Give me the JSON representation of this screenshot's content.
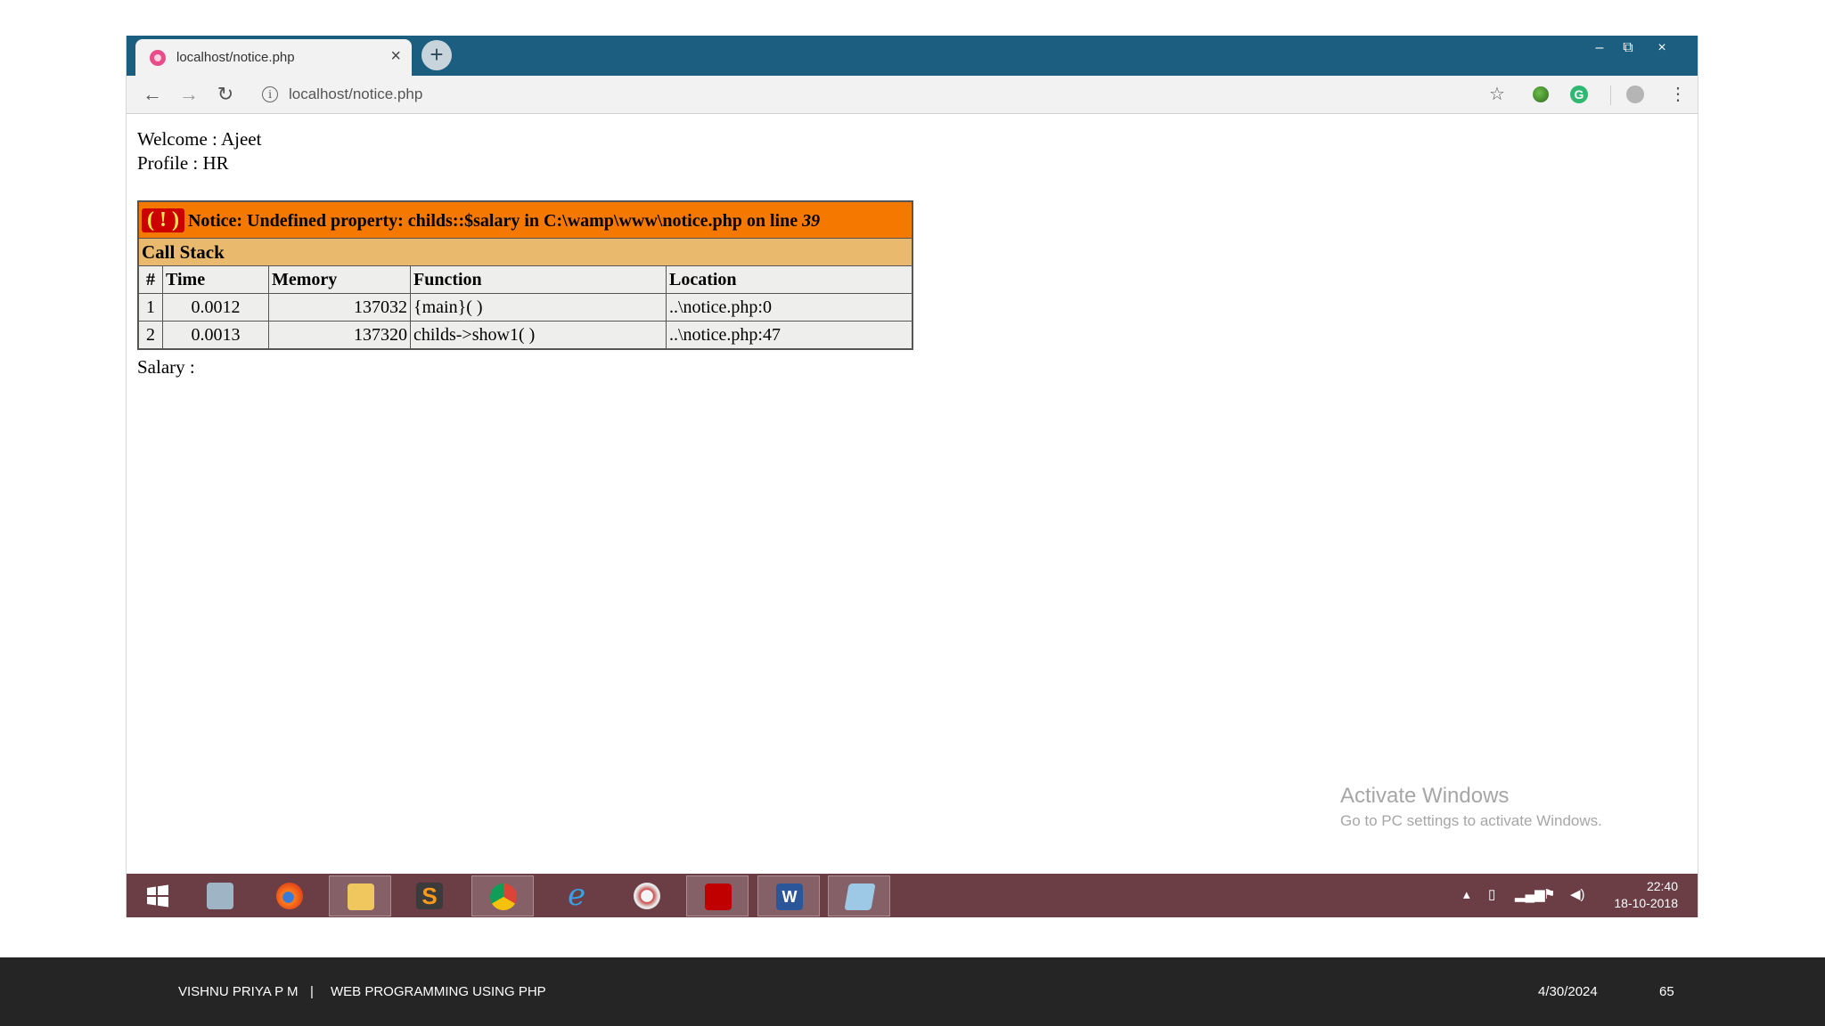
{
  "browser": {
    "tab_title": "localhost/notice.php",
    "tab_close": "×",
    "new_tab": "+",
    "url": "localhost/notice.php",
    "window_controls": {
      "minimize": "–",
      "restore": "⧉",
      "close": "×"
    }
  },
  "page": {
    "welcome": "Welcome : Ajeet",
    "profile": "Profile : HR",
    "notice": {
      "icon": "( ! )",
      "message": "Notice: Undefined property: childs::$salary in C:\\wamp\\www\\notice.php on line ",
      "line": "39"
    },
    "call_stack": {
      "title": "Call Stack",
      "headers": [
        "#",
        "Time",
        "Memory",
        "Function",
        "Location"
      ],
      "rows": [
        [
          "1",
          "0.0012",
          "137032",
          "{main}( )",
          "..\\notice.php:0"
        ],
        [
          "2",
          "0.0013",
          "137320",
          "childs->show1( )",
          "..\\notice.php:47"
        ]
      ]
    },
    "salary": "Salary :"
  },
  "watermark": {
    "title": "Activate Windows",
    "subtitle": "Go to PC settings to activate Windows."
  },
  "taskbar": {
    "apps": [
      "start-icon",
      "calculator-icon",
      "firefox-icon",
      "file-explorer-icon",
      "sublime-text-icon",
      "chrome-icon",
      "internet-explorer-icon",
      "paint-icon",
      "acrobat-icon",
      "word-icon",
      "notepad-icon"
    ],
    "clock_time": "22:40",
    "clock_date": "18-10-2018"
  },
  "footer": {
    "author": "VISHNU PRIYA P M",
    "divider": "|",
    "course": "WEB PROGRAMMING USING PHP",
    "date": "4/30/2024",
    "slide_number": "65"
  },
  "colors": {
    "titlebar": "#1b5e7f",
    "notice_bg": "#f57900",
    "callstack_bg": "#e9b96e",
    "taskbar": "#6b3e45",
    "footer": "#252525"
  }
}
